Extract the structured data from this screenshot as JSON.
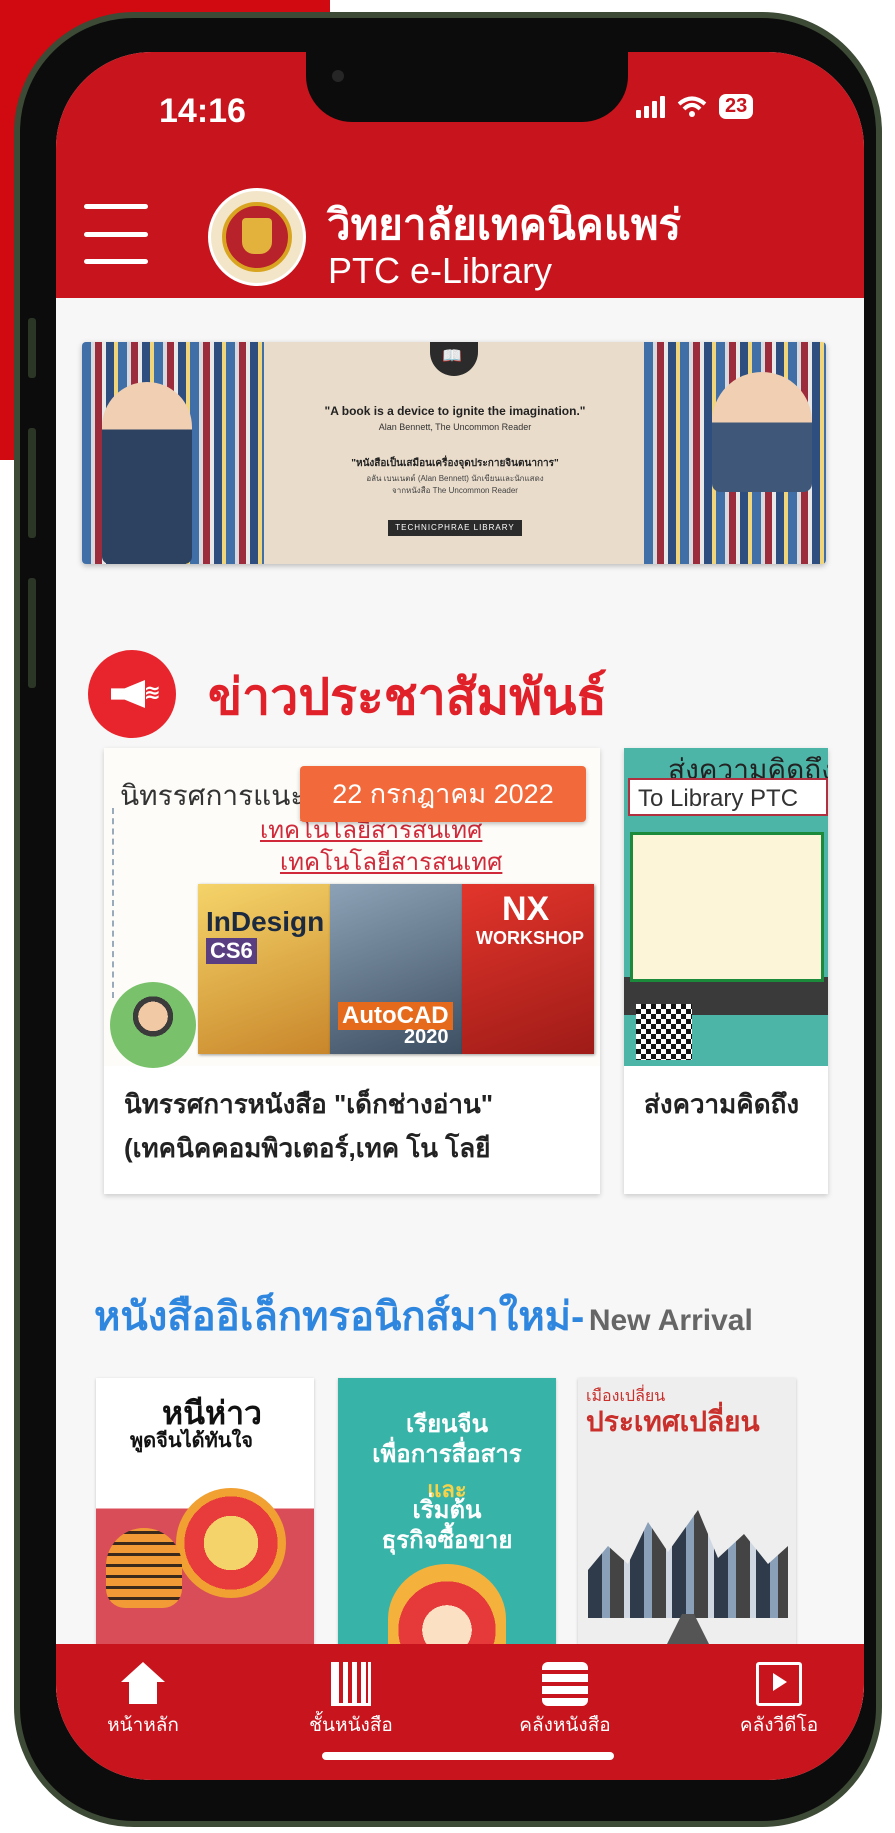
{
  "status_bar": {
    "time": "14:16",
    "battery": "23"
  },
  "header": {
    "title": "วิทยาลัยเทคนิคแพร่",
    "subtitle": "PTC e-Library"
  },
  "banner": {
    "quote_en": "\"A book is a device to ignite the imagination.\"",
    "quote_en_author": "Alan Bennett, The Uncommon Reader",
    "quote_th": "\"หนังสือเป็นเสมือนเครื่องจุดประกายจินตนาการ\"",
    "quote_th_author": "อลัน เบนเนตต์ (Alan Bennett) นักเขียนและนักแสดง",
    "quote_th_source": "จากหนังสือ The Uncommon Reader",
    "tag": "TECHNICPHRAE LIBRARY"
  },
  "pr_section": {
    "title": "ข่าวประชาสัมพันธ์"
  },
  "news": [
    {
      "date": "22 กรกฎาคม 2022",
      "image_heading": "นิทรรศการแนะน",
      "image_sub1": "เทคโนโลยีสารสนเทศ",
      "image_sub2": "เทคโนโลยีสารสนเทศ",
      "books": [
        {
          "title": "InDesign",
          "tag": "CS6"
        },
        {
          "title": "AutoCAD",
          "tag": "2020"
        },
        {
          "title": "NX",
          "tag": "WORKSHOP"
        }
      ],
      "title_line1": "นิทรรศการหนังสือ \"เด็กช่างอ่าน\"",
      "title_line2": "(เทคนิคคอมพิวเตอร์,เทค โน โลยี"
    },
    {
      "image_heading": "ส่งความคิดถึง",
      "image_banner": "To Library PTC",
      "title_line1": "ส่งความคิดถึง"
    }
  ],
  "new_arrival": {
    "heading_th": "หนังสืออิเล็กทรอนิกส์มาใหม่-",
    "heading_en": "New Arrival"
  },
  "ebooks": [
    {
      "title": "หนีห่าว",
      "subtitle": "พูดจีนได้ทันใจ"
    },
    {
      "title": "เรียนจีน\nเพื่อการสื่อสาร",
      "title2": "และ",
      "title3": "เริ่มต้น\nธุรกิจซื้อขาย"
    },
    {
      "title": "ประเทศเปลี่ยน",
      "subtitle": "เมืองเปลี่ยน"
    }
  ],
  "tabbar": {
    "home": "หน้าหลัก",
    "shelf": "ชั้นหนังสือ",
    "library": "คลังหนังสือ",
    "video": "คลังวีดีโอ"
  }
}
